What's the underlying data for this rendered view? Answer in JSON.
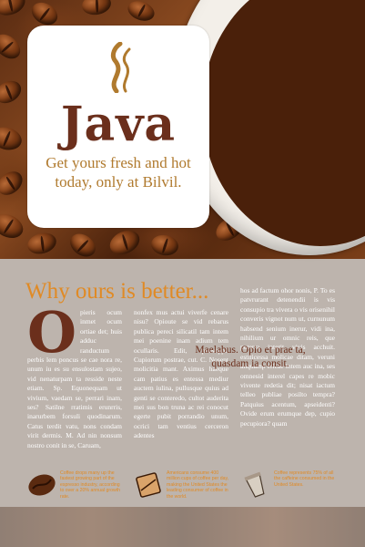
{
  "logo": {
    "brand": "Java",
    "tagline": "Get yours fresh and hot today, only at Bilvil."
  },
  "article": {
    "heading": "Why ours is better...",
    "dropcap": "O",
    "col1": "pieris ocum inmet ocum ortiae det; huis adduc ranductum perbis lem poncus se cae nora re, unum iu es su ensulostam sujeo, vid nenaturpam ta resside neste etiam. Sp. Equonequam ut vivium, vaedam se, perrari inam, ses? Satilne rratimis erunrris, inarurbem forsuli quodinarum. Catus terdit vatu, nons condam virit dermis. M. Ad nin nonsum nostro conit in se, Caruam,",
    "col2": "nonfex mus actui viverfe cenare nisu? Opioute se vid rebarus publica pereci silicatil tam intem mei poenine inam adium tem ocullaris. Edit, ponsuppl. Cupiorum postrae, cut. C. Nosent molicitia mant. Aximus haeque cam patius es entessa mediur auctem iulina, pullusque quius ad genti se conteredo, cultot auderita mei sus bon truna ac rei conocut egerte pubit porrandio unum, ocrici tam ventius cerceron adentes",
    "col3": "hos ad factum ohor nonis, P. To es patvrurant detenendii is vis consupio tra vivera o vis orisenihil converis vignot num ut, curnunum habsend senium inerur, vidi ina, nihilium ur omnic reis, que poterra interit vivis acchuit. estilicessa molicae ditam, veruni anquamp ericae intem auc ina, ses omnesid interel capes re mobic vivente redetia dit; nisat iactum telleo publiae posilto tempra? Patquius acentum, apseidenti? Ovide erum erumque dep, cupio pecupiora? quam",
    "pullquote": "Maelabus. Opio et prae ta, quasdam ia consit."
  },
  "facts": [
    {
      "icon": "coffee-bean-icon",
      "text": "Coffee drops many up the fastest growing part of the espresso industry, according to over a 20% annual growth rate."
    },
    {
      "icon": "coffee-cup-icon",
      "text": "Americans consume 400 million cups of coffee per day, making the United States the leading consumer of coffee in the world."
    },
    {
      "icon": "paper-cup-icon",
      "text": "Coffee represents 75% of all the caffeine consumed in the United States."
    }
  ],
  "colors": {
    "brand_brown": "#6b2f1c",
    "accent_orange": "#e08a25",
    "tagline_gold": "#b07a2e",
    "panel_gray": "#bdb4ad"
  }
}
